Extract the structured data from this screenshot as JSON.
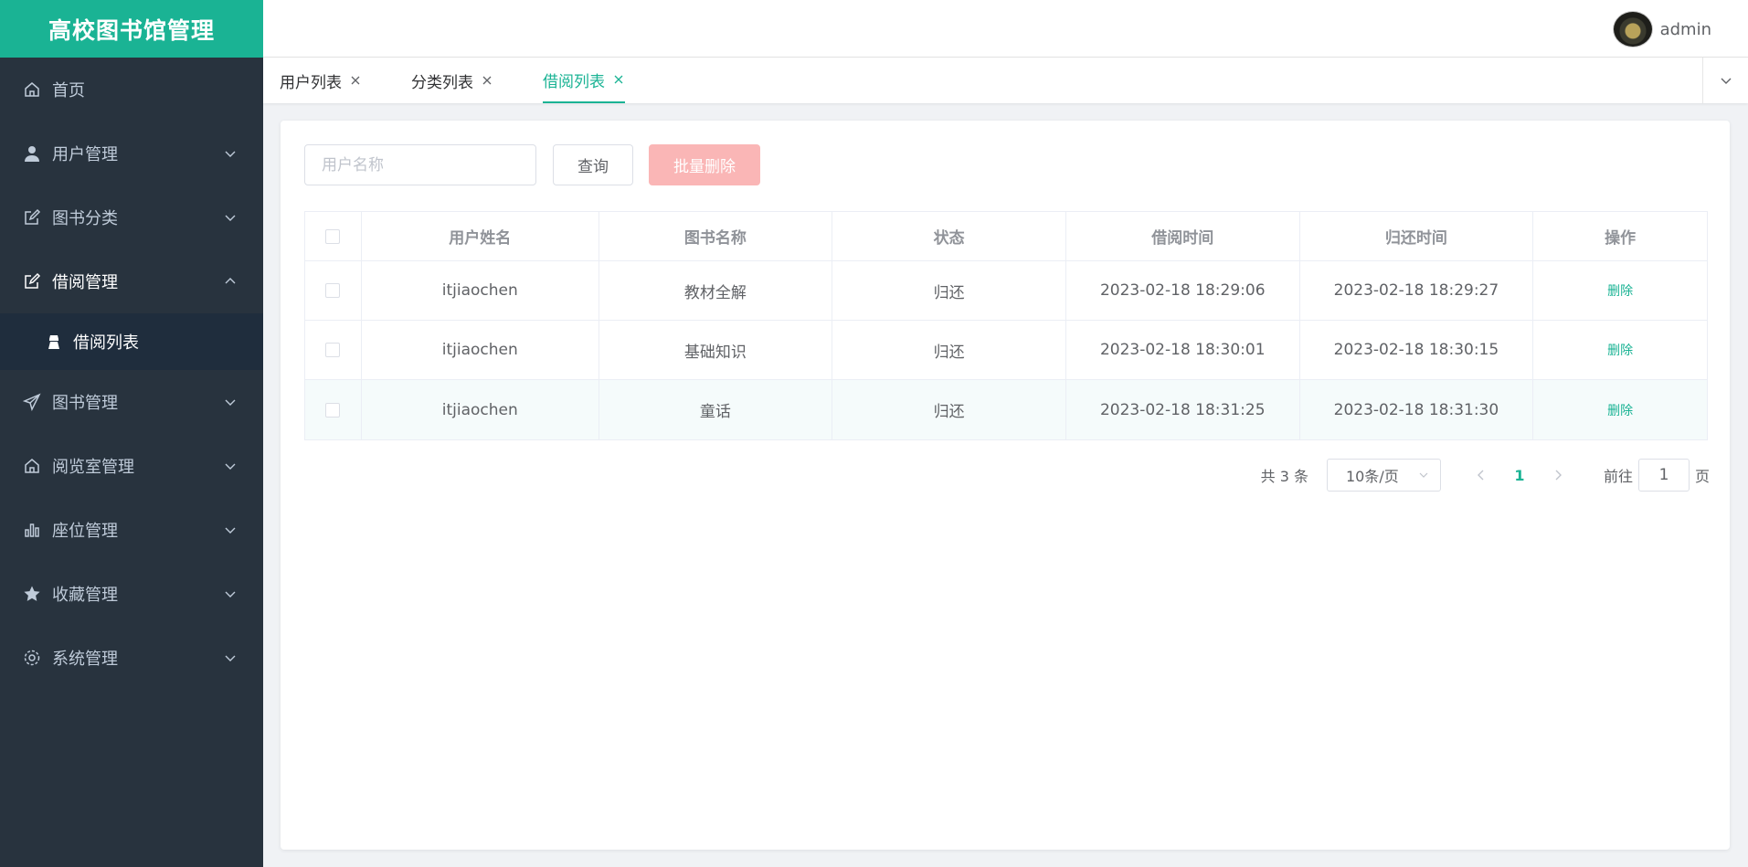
{
  "app": {
    "title": "高校图书馆管理"
  },
  "user": {
    "name": "admin"
  },
  "sidebar": {
    "items": [
      {
        "label": "首页",
        "icon": "home-icon",
        "hasArrow": false
      },
      {
        "label": "用户管理",
        "icon": "user-icon",
        "hasArrow": true
      },
      {
        "label": "图书分类",
        "icon": "edit-icon",
        "hasArrow": true
      },
      {
        "label": "借阅管理",
        "icon": "edit-icon",
        "hasArrow": true,
        "open": true
      },
      {
        "label": "图书管理",
        "icon": "send-icon",
        "hasArrow": true
      },
      {
        "label": "阅览室管理",
        "icon": "home-icon",
        "hasArrow": true
      },
      {
        "label": "座位管理",
        "icon": "bar-chart-icon",
        "hasArrow": true
      },
      {
        "label": "收藏管理",
        "icon": "star-icon",
        "hasArrow": true
      },
      {
        "label": "系统管理",
        "icon": "gear-icon",
        "hasArrow": true
      }
    ],
    "submenu": {
      "label": "借阅列表",
      "icon": "reader-icon"
    }
  },
  "tabs": [
    {
      "label": "用户列表",
      "active": false
    },
    {
      "label": "分类列表",
      "active": false
    },
    {
      "label": "借阅列表",
      "active": true
    }
  ],
  "search": {
    "placeholder": "用户名称",
    "value": ""
  },
  "buttons": {
    "query": "查询",
    "batch_delete": "批量删除"
  },
  "table": {
    "columns": [
      "用户姓名",
      "图书名称",
      "状态",
      "借阅时间",
      "归还时间",
      "操作"
    ],
    "rows": [
      {
        "user": "itjiaochen",
        "book": "教材全解",
        "status": "归还",
        "borrow_time": "2023-02-18 18:29:06",
        "return_time": "2023-02-18 18:29:27",
        "action": "删除"
      },
      {
        "user": "itjiaochen",
        "book": "基础知识",
        "status": "归还",
        "borrow_time": "2023-02-18 18:30:01",
        "return_time": "2023-02-18 18:30:15",
        "action": "删除"
      },
      {
        "user": "itjiaochen",
        "book": "童话",
        "status": "归还",
        "borrow_time": "2023-02-18 18:31:25",
        "return_time": "2023-02-18 18:31:30",
        "action": "删除"
      }
    ]
  },
  "pagination": {
    "total_text": "共 3 条",
    "page_size": "10条/页",
    "current_page": "1",
    "goto_label": "前往",
    "goto_value": "1",
    "page_unit": "页"
  },
  "colors": {
    "accent": "#1ab394",
    "sidebar": "#28333e",
    "danger_disabled": "#fab6b6"
  }
}
